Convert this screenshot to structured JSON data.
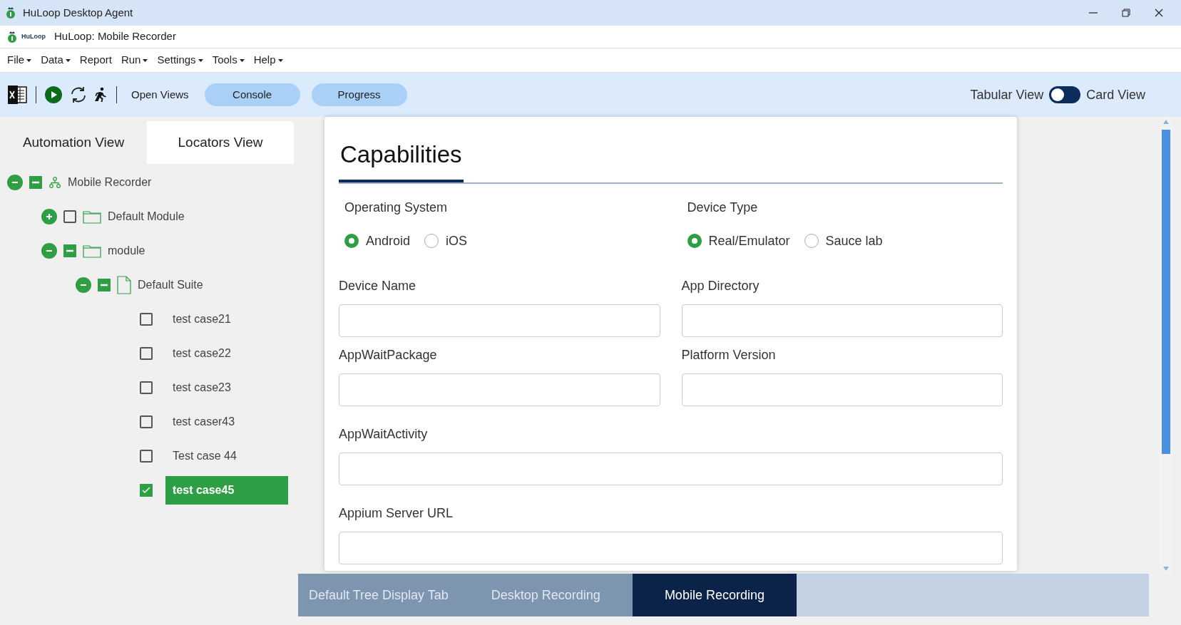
{
  "window": {
    "title": "HuLoop Desktop Agent"
  },
  "app_header": {
    "logo_text": "HuLoop",
    "title": "HuLoop: Mobile Recorder"
  },
  "menu": [
    {
      "label": "File",
      "dropdown": true
    },
    {
      "label": "Data",
      "dropdown": true
    },
    {
      "label": "Report",
      "dropdown": false
    },
    {
      "label": "Run",
      "dropdown": true
    },
    {
      "label": "Settings",
      "dropdown": true
    },
    {
      "label": "Tools",
      "dropdown": true
    },
    {
      "label": "Help",
      "dropdown": true
    }
  ],
  "toolbar": {
    "open_views": "Open Views",
    "buttons": [
      "Console",
      "Progress"
    ],
    "toggle": {
      "left_label": "Tabular View",
      "right_label": "Card View",
      "on": false
    }
  },
  "side_tabs": [
    {
      "label": "Automation View",
      "selected": false
    },
    {
      "label": "Locators View",
      "selected": true
    }
  ],
  "tree": [
    {
      "label": "Mobile Recorder",
      "kind": "project",
      "expanded": true,
      "checked": true,
      "partial": true,
      "selected": false,
      "children": [
        {
          "label": "Default Module",
          "kind": "folder",
          "expanded": false,
          "checked": false,
          "partial": false,
          "selected": false
        },
        {
          "label": "module",
          "kind": "folder",
          "expanded": true,
          "checked": true,
          "partial": true,
          "selected": false,
          "children": [
            {
              "label": "Default Suite",
              "kind": "suite",
              "expanded": true,
              "checked": true,
              "partial": true,
              "selected": false,
              "children": [
                {
                  "label": "test case21",
                  "kind": "case",
                  "checked": false,
                  "partial": false,
                  "selected": false
                },
                {
                  "label": "test case22",
                  "kind": "case",
                  "checked": false,
                  "partial": false,
                  "selected": false
                },
                {
                  "label": "test case23",
                  "kind": "case",
                  "checked": false,
                  "partial": false,
                  "selected": false
                },
                {
                  "label": "test caser43",
                  "kind": "case",
                  "checked": false,
                  "partial": false,
                  "selected": false
                },
                {
                  "label": "Test case 44",
                  "kind": "case",
                  "checked": false,
                  "partial": false,
                  "selected": false
                },
                {
                  "label": "test case45",
                  "kind": "case",
                  "checked": true,
                  "partial": false,
                  "selected": true
                }
              ]
            }
          ]
        }
      ]
    }
  ],
  "card": {
    "title": "Capabilities",
    "radio_groups": [
      {
        "label": "Operating System",
        "options": [
          {
            "label": "Android",
            "selected": true
          },
          {
            "label": "iOS",
            "selected": false
          }
        ]
      },
      {
        "label": "Device Type",
        "options": [
          {
            "label": "Real/Emulator",
            "selected": true
          },
          {
            "label": "Sauce lab",
            "selected": false
          }
        ]
      }
    ],
    "fields": [
      {
        "label": "Device Name",
        "wide": false
      },
      {
        "label": "App Directory",
        "wide": false
      },
      {
        "label": "AppWaitPackage",
        "wide": false
      },
      {
        "label": "Platform Version",
        "wide": false
      },
      {
        "label": "AppWaitActivity",
        "wide": true
      },
      {
        "label": "Appium Server URL",
        "wide": true
      }
    ]
  },
  "bottom_tabs": [
    {
      "label": "Default Tree Display Tab",
      "selected": false
    },
    {
      "label": "Desktop Recording",
      "selected": false
    },
    {
      "label": "Mobile Recording",
      "selected": true
    }
  ]
}
